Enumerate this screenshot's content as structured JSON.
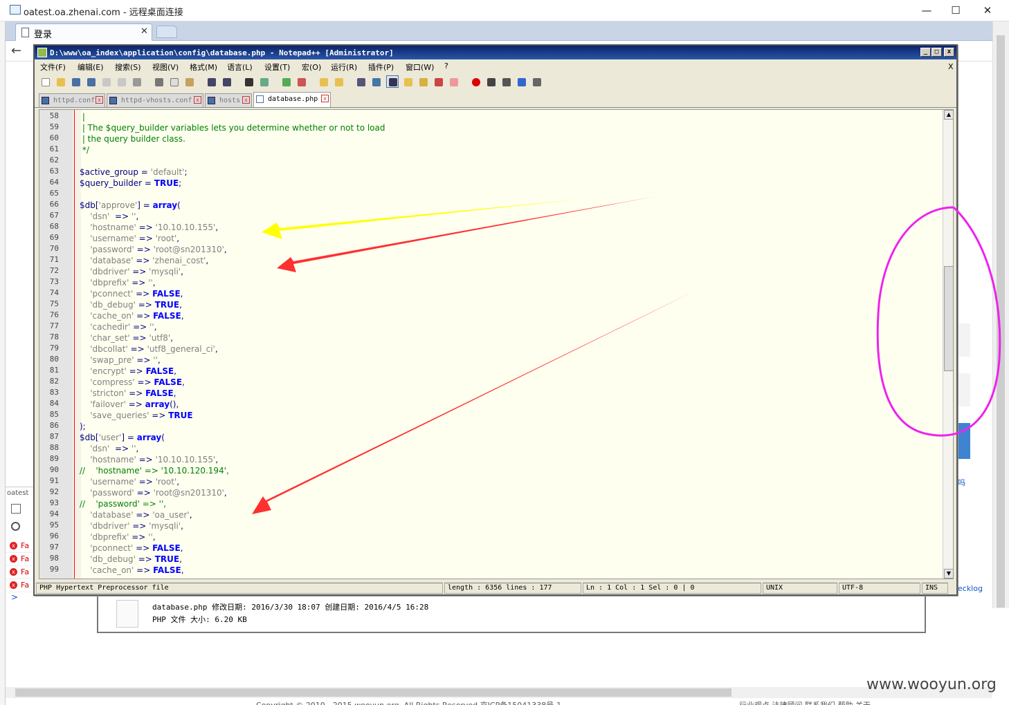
{
  "rdp": {
    "title": "oatest.oa.zhenai.com - 远程桌面连接",
    "minimize": "—",
    "maximize": "☐",
    "close": "✕"
  },
  "browser": {
    "tab_label": "登录",
    "tab_close": "✕",
    "back": "←",
    "devtools_tab": "oatest",
    "devtools_rows": [
      "Fa",
      "Fa",
      "Fa",
      "Fa"
    ],
    "prompt": ">",
    "right_link": "ecklog",
    "right_link2": "吗",
    "footer": "Copyright © 2010 - 2015 wooyun.org, All Rights Reserved 京ICP备15041338号-1",
    "footer_right": "行业观点   法律顾问   联系我们   帮助   关于"
  },
  "watermark": "www.wooyun.org",
  "npp": {
    "title": "D:\\www\\oa_index\\application\\config\\database.php - Notepad++ [Administrator]",
    "menu": [
      "文件(F)",
      "编辑(E)",
      "搜索(S)",
      "视图(V)",
      "格式(M)",
      "语言(L)",
      "设置(T)",
      "宏(O)",
      "运行(R)",
      "插件(P)",
      "窗口(W)",
      "?"
    ],
    "menu_close": "X",
    "tabs": [
      {
        "label": "httpd.conf",
        "active": false
      },
      {
        "label": "httpd-vhosts.conf",
        "active": false
      },
      {
        "label": "hosts",
        "active": false
      },
      {
        "label": "database.php",
        "active": true
      }
    ],
    "tab_close": "x",
    "status": {
      "type": "PHP Hypertext Preprocessor file",
      "length": "length : 6356    lines : 177",
      "pos": "Ln : 1    Col : 1    Sel : 0 | 0",
      "eol": "UNIX",
      "enc": "UTF-8",
      "ins": "INS"
    }
  },
  "code": [
    {
      "n": "58",
      "t": [
        [
          "cm",
          " |"
        ]
      ]
    },
    {
      "n": "59",
      "t": [
        [
          "cm",
          " | The $query_builder variables lets you determine whether or not to load"
        ]
      ]
    },
    {
      "n": "60",
      "t": [
        [
          "cm",
          " | the query builder class."
        ]
      ]
    },
    {
      "n": "61",
      "t": [
        [
          "cm",
          " */"
        ]
      ]
    },
    {
      "n": "62",
      "t": []
    },
    {
      "n": "63",
      "t": [
        [
          "vr",
          "$active_group"
        ],
        [
          "op",
          " = "
        ],
        [
          "st",
          "'default'"
        ],
        [
          "op",
          ";"
        ]
      ]
    },
    {
      "n": "64",
      "t": [
        [
          "vr",
          "$query_builder"
        ],
        [
          "op",
          " = "
        ],
        [
          "kw",
          "TRUE"
        ],
        [
          "op",
          ";"
        ]
      ]
    },
    {
      "n": "65",
      "t": []
    },
    {
      "n": "66",
      "t": [
        [
          "vr",
          "$db"
        ],
        [
          "op",
          "["
        ],
        [
          "st",
          "'approve'"
        ],
        [
          "op",
          "] = "
        ],
        [
          "kw",
          "array"
        ],
        [
          "op",
          "("
        ]
      ]
    },
    {
      "n": "67",
      "t": [
        [
          "st",
          "    'dsn'"
        ],
        [
          "op",
          "  => "
        ],
        [
          "st",
          "''"
        ],
        [
          "op",
          ","
        ]
      ]
    },
    {
      "n": "68",
      "t": [
        [
          "st",
          "    'hostname'"
        ],
        [
          "op",
          " => "
        ],
        [
          "st",
          "'10.10.10.155'"
        ],
        [
          "op",
          ","
        ]
      ]
    },
    {
      "n": "69",
      "t": [
        [
          "st",
          "    'username'"
        ],
        [
          "op",
          " => "
        ],
        [
          "st",
          "'root'"
        ],
        [
          "op",
          ","
        ]
      ]
    },
    {
      "n": "70",
      "t": [
        [
          "st",
          "    'password'"
        ],
        [
          "op",
          " => "
        ],
        [
          "st",
          "'root@sn201310'"
        ],
        [
          "op",
          ","
        ]
      ]
    },
    {
      "n": "71",
      "t": [
        [
          "st",
          "    'database'"
        ],
        [
          "op",
          " => "
        ],
        [
          "st",
          "'zhenai_cost'"
        ],
        [
          "op",
          ","
        ]
      ]
    },
    {
      "n": "72",
      "t": [
        [
          "st",
          "    'dbdriver'"
        ],
        [
          "op",
          " => "
        ],
        [
          "st",
          "'mysqli'"
        ],
        [
          "op",
          ","
        ]
      ]
    },
    {
      "n": "73",
      "t": [
        [
          "st",
          "    'dbprefix'"
        ],
        [
          "op",
          " => "
        ],
        [
          "st",
          "''"
        ],
        [
          "op",
          ","
        ]
      ]
    },
    {
      "n": "74",
      "t": [
        [
          "st",
          "    'pconnect'"
        ],
        [
          "op",
          " => "
        ],
        [
          "kw",
          "FALSE"
        ],
        [
          "op",
          ","
        ]
      ]
    },
    {
      "n": "75",
      "t": [
        [
          "st",
          "    'db_debug'"
        ],
        [
          "op",
          " => "
        ],
        [
          "kw",
          "TRUE"
        ],
        [
          "op",
          ","
        ]
      ]
    },
    {
      "n": "76",
      "t": [
        [
          "st",
          "    'cache_on'"
        ],
        [
          "op",
          " => "
        ],
        [
          "kw",
          "FALSE"
        ],
        [
          "op",
          ","
        ]
      ]
    },
    {
      "n": "77",
      "t": [
        [
          "st",
          "    'cachedir'"
        ],
        [
          "op",
          " => "
        ],
        [
          "st",
          "''"
        ],
        [
          "op",
          ","
        ]
      ]
    },
    {
      "n": "78",
      "t": [
        [
          "st",
          "    'char_set'"
        ],
        [
          "op",
          " => "
        ],
        [
          "st",
          "'utf8'"
        ],
        [
          "op",
          ","
        ]
      ]
    },
    {
      "n": "79",
      "t": [
        [
          "st",
          "    'dbcollat'"
        ],
        [
          "op",
          " => "
        ],
        [
          "st",
          "'utf8_general_ci'"
        ],
        [
          "op",
          ","
        ]
      ]
    },
    {
      "n": "80",
      "t": [
        [
          "st",
          "    'swap_pre'"
        ],
        [
          "op",
          " => "
        ],
        [
          "st",
          "''"
        ],
        [
          "op",
          ","
        ]
      ]
    },
    {
      "n": "81",
      "t": [
        [
          "st",
          "    'encrypt'"
        ],
        [
          "op",
          " => "
        ],
        [
          "kw",
          "FALSE"
        ],
        [
          "op",
          ","
        ]
      ]
    },
    {
      "n": "82",
      "t": [
        [
          "st",
          "    'compress'"
        ],
        [
          "op",
          " => "
        ],
        [
          "kw",
          "FALSE"
        ],
        [
          "op",
          ","
        ]
      ]
    },
    {
      "n": "83",
      "t": [
        [
          "st",
          "    'stricton'"
        ],
        [
          "op",
          " => "
        ],
        [
          "kw",
          "FALSE"
        ],
        [
          "op",
          ","
        ]
      ]
    },
    {
      "n": "84",
      "t": [
        [
          "st",
          "    'failover'"
        ],
        [
          "op",
          " => "
        ],
        [
          "kw",
          "array"
        ],
        [
          "op",
          "(),"
        ]
      ]
    },
    {
      "n": "85",
      "t": [
        [
          "st",
          "    'save_queries'"
        ],
        [
          "op",
          " => "
        ],
        [
          "kw",
          "TRUE"
        ]
      ]
    },
    {
      "n": "86",
      "t": [
        [
          "op",
          ");"
        ]
      ]
    },
    {
      "n": "87",
      "t": [
        [
          "vr",
          "$db"
        ],
        [
          "op",
          "["
        ],
        [
          "st",
          "'user'"
        ],
        [
          "op",
          "] = "
        ],
        [
          "kw",
          "array"
        ],
        [
          "op",
          "("
        ]
      ]
    },
    {
      "n": "88",
      "t": [
        [
          "st",
          "    'dsn'"
        ],
        [
          "op",
          "  => "
        ],
        [
          "st",
          "''"
        ],
        [
          "op",
          ","
        ]
      ]
    },
    {
      "n": "89",
      "t": [
        [
          "st",
          "    'hostname'"
        ],
        [
          "op",
          " => "
        ],
        [
          "st",
          "'10.10.10.155'"
        ],
        [
          "op",
          ","
        ]
      ]
    },
    {
      "n": "90",
      "t": [
        [
          "cm",
          "//    'hostname' => '10.10.120.194',"
        ]
      ]
    },
    {
      "n": "91",
      "t": [
        [
          "st",
          "    'username'"
        ],
        [
          "op",
          " => "
        ],
        [
          "st",
          "'root'"
        ],
        [
          "op",
          ","
        ]
      ]
    },
    {
      "n": "92",
      "t": [
        [
          "st",
          "    'password'"
        ],
        [
          "op",
          " => "
        ],
        [
          "st",
          "'root@sn201310'"
        ],
        [
          "op",
          ","
        ]
      ]
    },
    {
      "n": "93",
      "t": [
        [
          "cm",
          "//    'password' => '',"
        ]
      ]
    },
    {
      "n": "94",
      "t": [
        [
          "st",
          "    'database'"
        ],
        [
          "op",
          " => "
        ],
        [
          "st",
          "'oa_user'"
        ],
        [
          "op",
          ","
        ]
      ]
    },
    {
      "n": "95",
      "t": [
        [
          "st",
          "    'dbdriver'"
        ],
        [
          "op",
          " => "
        ],
        [
          "st",
          "'mysqli'"
        ],
        [
          "op",
          ","
        ]
      ]
    },
    {
      "n": "96",
      "t": [
        [
          "st",
          "    'dbprefix'"
        ],
        [
          "op",
          " => "
        ],
        [
          "st",
          "''"
        ],
        [
          "op",
          ","
        ]
      ]
    },
    {
      "n": "97",
      "t": [
        [
          "st",
          "    'pconnect'"
        ],
        [
          "op",
          " => "
        ],
        [
          "kw",
          "FALSE"
        ],
        [
          "op",
          ","
        ]
      ]
    },
    {
      "n": "98",
      "t": [
        [
          "st",
          "    'db_debug'"
        ],
        [
          "op",
          " => "
        ],
        [
          "kw",
          "TRUE"
        ],
        [
          "op",
          ","
        ]
      ]
    },
    {
      "n": "99",
      "t": [
        [
          "st",
          "    'cache_on'"
        ],
        [
          "op",
          " => "
        ],
        [
          "kw",
          "FALSE"
        ],
        [
          "op",
          ","
        ]
      ]
    }
  ],
  "fileinfo": {
    "line1": "database.php 修改日期: 2016/3/30 18:07        创建日期: 2016/4/5 16:28",
    "line2": "PHP 文件          大小: 6.20 KB"
  },
  "annotation_colors": {
    "yellow": "#ffff00",
    "red": "#ff3030",
    "magenta": "#ee22ee"
  }
}
